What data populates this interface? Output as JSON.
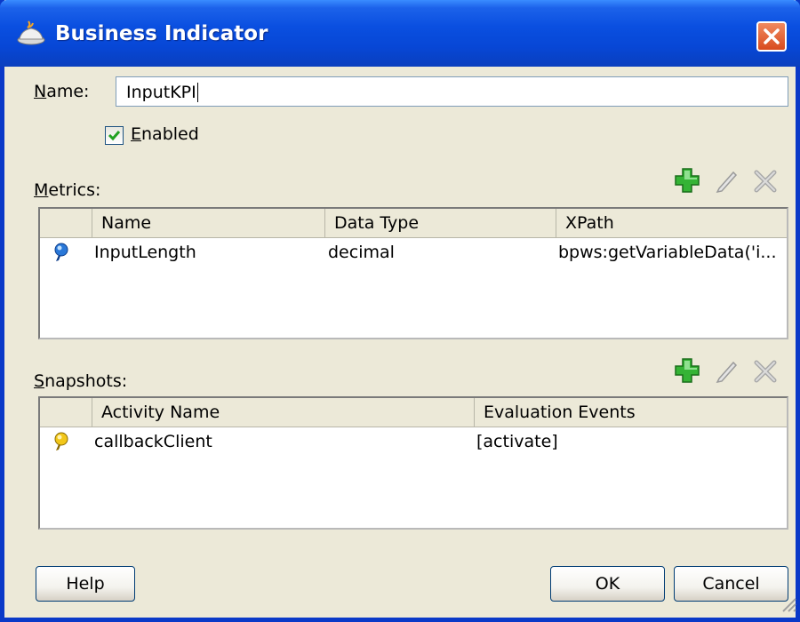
{
  "window": {
    "title": "Business Indicator"
  },
  "name_field": {
    "label_accel": "N",
    "label_rest": "ame:",
    "value": "InputKPI"
  },
  "enabled": {
    "label_accel": "E",
    "label_rest": "nabled",
    "checked": true
  },
  "metrics": {
    "label_pre": "",
    "label_accel": "M",
    "label_rest": "etrics:",
    "columns": [
      "Name",
      "Data Type",
      "XPath"
    ],
    "rows": [
      {
        "icon": "blue-key-icon",
        "name": "InputLength",
        "data_type": "decimal",
        "xpath": "bpws:getVariableData('i..."
      }
    ]
  },
  "snapshots": {
    "label_accel": "S",
    "label_rest": "napshots:",
    "columns": [
      "Activity Name",
      "Evaluation Events"
    ],
    "rows": [
      {
        "icon": "yellow-key-icon",
        "activity_name": "callbackClient",
        "evaluation_events": "[activate]"
      }
    ]
  },
  "buttons": {
    "help": "Help",
    "ok": "OK",
    "cancel": "Cancel"
  },
  "colors": {
    "title_bar": "#0a4fe0",
    "dialog_bg": "#ece9d8",
    "add_icon": "#2fa82f",
    "close_button": "#d84a1e"
  }
}
